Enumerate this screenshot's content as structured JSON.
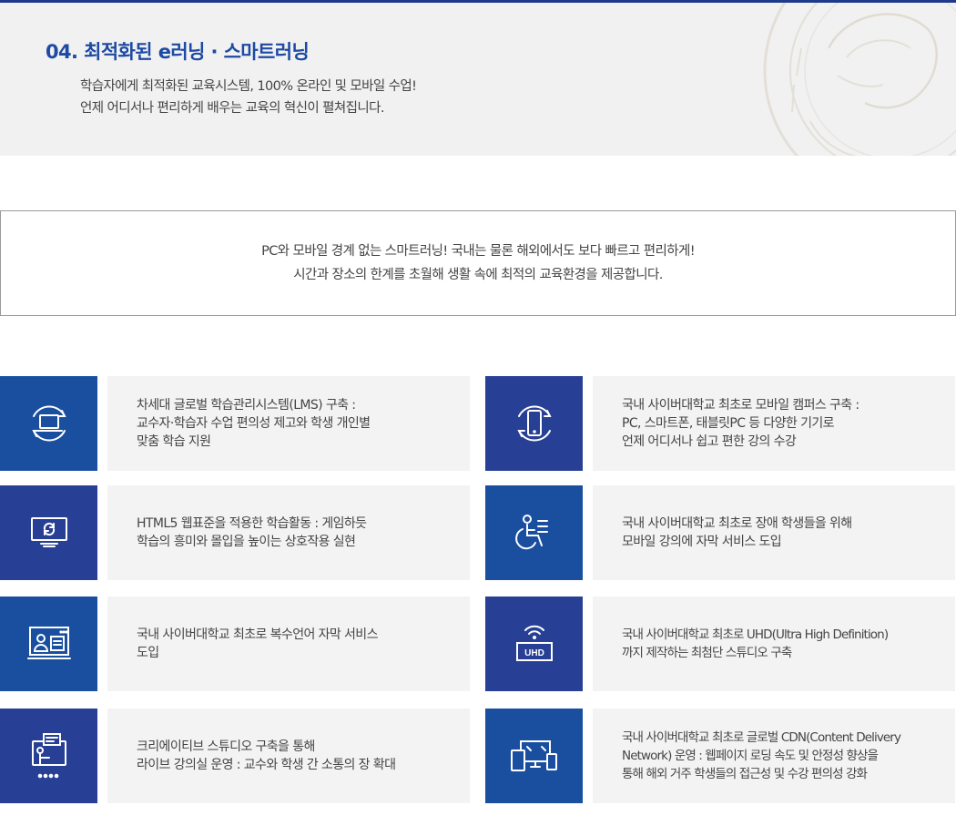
{
  "hero": {
    "title": "04. 최적화된 e러닝 · 스마트러닝",
    "desc_line1": "학습자에게 최적화된 교육시스템, 100% 온라인 및 모바일 수업!",
    "desc_line2": "언제 어디서나 편리하게 배우는 교육의 혁신이 펼쳐집니다.",
    "seal_icon": "university-seal-watermark"
  },
  "intro": {
    "line1": "PC와 모바일 경계 없는 스마트러닝! 국내는 물론 해외에서도 보다 빠르고 편리하게!",
    "line2": "시간과 장소의 한계를 초월해 생활 속에 최적의 교육환경을 제공합니다."
  },
  "colors": {
    "accent_blue": "#1a4fa0",
    "navy_blue": "#273f95",
    "card_bg": "#f3f3f3",
    "hero_bg": "#f1f1f1"
  },
  "features": [
    {
      "icon": "laptop-sync-icon",
      "lines": [
        "차세대 글로벌 학습관리시스템(LMS) 구축 :",
        "교수자·학습자 수업 편의성 제고와 학생 개인별",
        "맞춤 학습 지원"
      ]
    },
    {
      "icon": "mobile-sync-icon",
      "lines": [
        "국내 사이버대학교 최초로 모바일 캠퍼스 구축 :",
        "PC, 스마트폰, 태블릿PC 등 다양한 기기로",
        "언제 어디서나 쉽고 편한 강의 수강"
      ]
    },
    {
      "icon": "monitor-refresh-icon",
      "lines": [
        "HTML5 웹표준을 적용한 학습활동 : 게임하듯",
        "학습의 흥미와 몰입을 높이는 상호작용 실현"
      ]
    },
    {
      "icon": "accessibility-icon",
      "lines": [
        "국내 사이버대학교 최초로 장애 학생들을 위해",
        "모바일 강의에 자막 서비스 도입"
      ]
    },
    {
      "icon": "caption-screen-icon",
      "lines": [
        "국내 사이버대학교 최초로 복수언어 자막 서비스",
        "도입"
      ]
    },
    {
      "icon": "uhd-broadcast-icon",
      "uhd_label": "UHD",
      "lines": [
        "국내 사이버대학교 최초로 UHD(Ultra High Definition)",
        "까지 제작하는 최첨단 스튜디오 구축"
      ]
    },
    {
      "icon": "live-lecture-icon",
      "lines": [
        "크리에이티브 스튜디오 구축을 통해",
        "라이브 강의실 운영 : 교수와 학생 간 소통의 장 확대"
      ]
    },
    {
      "icon": "multi-device-icon",
      "lines": [
        "국내 사이버대학교 최초로 글로벌 CDN(Content Delivery",
        "Network) 운영 : 웹페이지 로딩 속도 및 안정성 향상을",
        "통해 해외 거주 학생들의 접근성 및 수강 편의성 강화"
      ]
    }
  ]
}
